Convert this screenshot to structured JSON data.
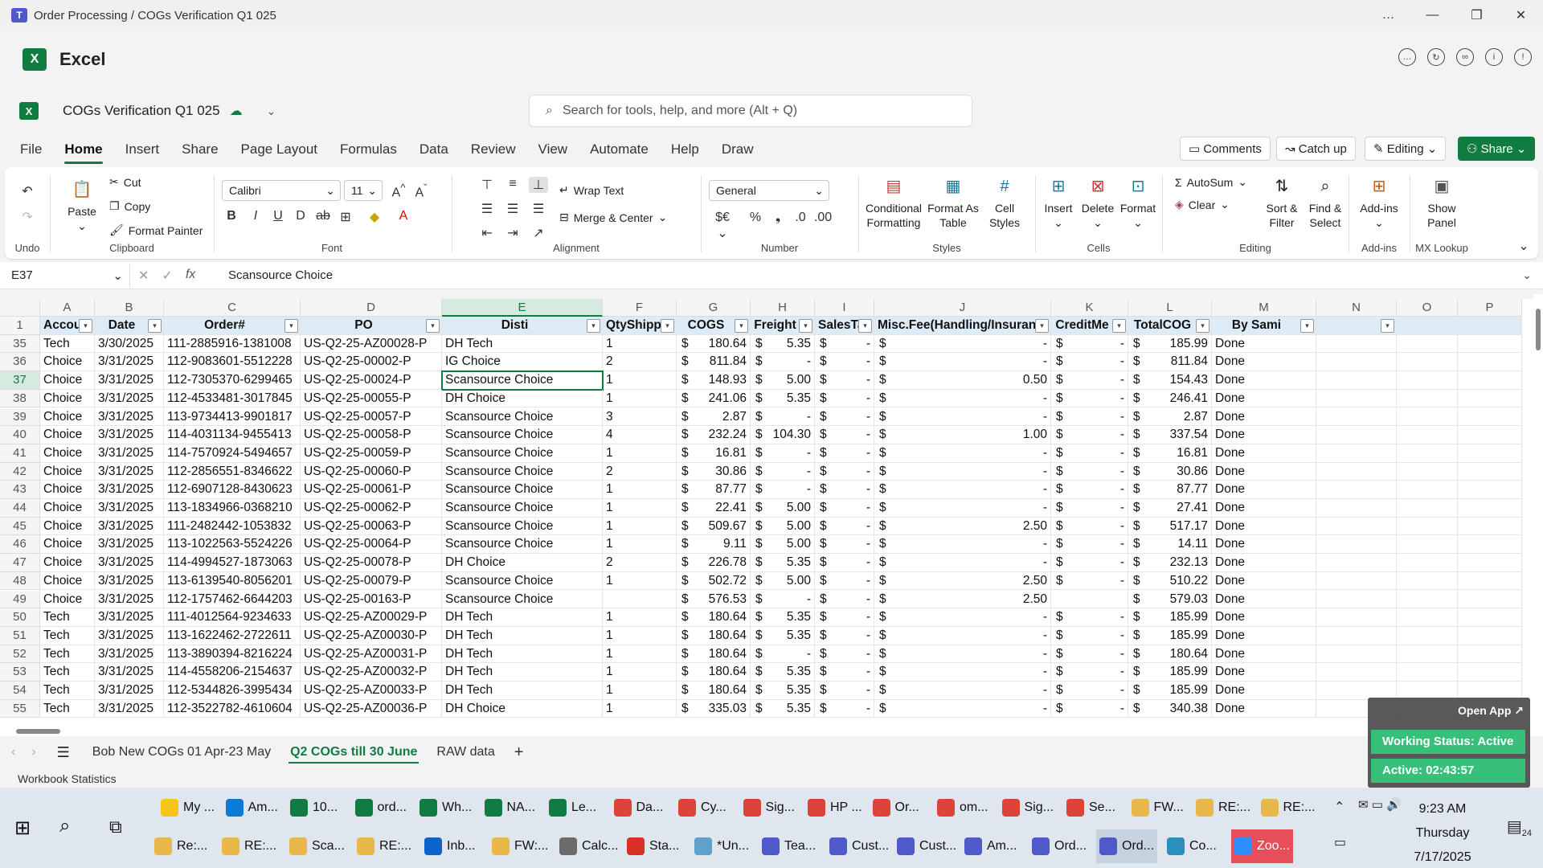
{
  "window": {
    "title": "Order Processing / COGs Verification Q1 025",
    "controls": [
      "…",
      "—",
      "❐",
      "✕"
    ]
  },
  "app": {
    "name": "Excel",
    "logo": "X"
  },
  "file": {
    "name": "COGs Verification Q1 025"
  },
  "search": {
    "placeholder": "Search for tools, help, and more (Alt + Q)"
  },
  "menu": {
    "tabs": [
      "File",
      "Home",
      "Insert",
      "Share",
      "Page Layout",
      "Formulas",
      "Data",
      "Review",
      "View",
      "Automate",
      "Help",
      "Draw"
    ],
    "active": "Home",
    "comments": "Comments",
    "catchup": "Catch up",
    "editing": "Editing",
    "share": "Share"
  },
  "ribbon": {
    "undo_label": "Undo",
    "clipboard": {
      "paste": "Paste",
      "cut": "Cut",
      "copy": "Copy",
      "format_painter": "Format Painter",
      "label": "Clipboard"
    },
    "font": {
      "name": "Calibri",
      "size": "11",
      "label": "Font"
    },
    "alignment": {
      "wrap": "Wrap Text",
      "merge": "Merge & Center",
      "label": "Alignment"
    },
    "number": {
      "format": "General",
      "label": "Number"
    },
    "styles": {
      "conditional": "Conditional Formatting",
      "format_table": "Format As Table",
      "cell_styles": "Cell Styles",
      "label": "Styles"
    },
    "cells": {
      "insert": "Insert",
      "delete": "Delete",
      "format": "Format",
      "label": "Cells"
    },
    "editing": {
      "autosum": "AutoSum",
      "clear": "Clear",
      "sort": "Sort & Filter",
      "find": "Find & Select",
      "label": "Editing"
    },
    "addins": {
      "label_btn": "Add-ins",
      "label": "Add-ins"
    },
    "mxlookup": {
      "btn": "Show Panel",
      "label": "MX Lookup"
    }
  },
  "formula_bar": {
    "cell_ref": "E37",
    "value": "Scansource Choice",
    "fx": "fx"
  },
  "grid": {
    "columns": [
      "A",
      "B",
      "C",
      "D",
      "E",
      "F",
      "G",
      "H",
      "I",
      "J",
      "K",
      "L",
      "M",
      "N",
      "O",
      "P"
    ],
    "selected_column": "E",
    "headers": [
      "Accou",
      "Date",
      "Order#",
      "PO",
      "Disti",
      "QtyShipp",
      "COGS",
      "Freight",
      "SalesTa",
      "Misc.Fee(Handling/Insuranc",
      "CreditMe",
      "TotalCOG",
      "By Sami",
      "",
      "",
      ""
    ],
    "rows": [
      {
        "n": "35",
        "a": "Tech",
        "b": "3/30/2025",
        "c": "111-2885916-1381008",
        "d": "US-Q2-25-AZ00028-P",
        "e": "DH Tech",
        "f": "1",
        "g": "180.64",
        "h": "5.35",
        "i": "-",
        "j": "-",
        "k": "-",
        "l": "185.99",
        "m": "Done"
      },
      {
        "n": "36",
        "a": "Choice",
        "b": "3/31/2025",
        "c": "112-9083601-5512228",
        "d": "US-Q2-25-00002-P",
        "e": "IG Choice",
        "f": "2",
        "g": "811.84",
        "h": "-",
        "i": "-",
        "j": "-",
        "k": "-",
        "l": "811.84",
        "m": "Done"
      },
      {
        "n": "37",
        "a": "Choice",
        "b": "3/31/2025",
        "c": "112-7305370-6299465",
        "d": "US-Q2-25-00024-P",
        "e": "Scansource Choice",
        "f": "1",
        "g": "148.93",
        "h": "5.00",
        "i": "-",
        "j": "0.50",
        "k": "-",
        "l": "154.43",
        "m": "Done"
      },
      {
        "n": "38",
        "a": "Choice",
        "b": "3/31/2025",
        "c": "112-4533481-3017845",
        "d": "US-Q2-25-00055-P",
        "e": "DH Choice",
        "f": "1",
        "g": "241.06",
        "h": "5.35",
        "i": "-",
        "j": "-",
        "k": "-",
        "l": "246.41",
        "m": "Done"
      },
      {
        "n": "39",
        "a": "Choice",
        "b": "3/31/2025",
        "c": "113-9734413-9901817",
        "d": "US-Q2-25-00057-P",
        "e": "Scansource Choice",
        "f": "3",
        "g": "2.87",
        "h": "-",
        "i": "-",
        "j": "-",
        "k": "-",
        "l": "2.87",
        "m": "Done"
      },
      {
        "n": "40",
        "a": "Choice",
        "b": "3/31/2025",
        "c": "114-4031134-9455413",
        "d": "US-Q2-25-00058-P",
        "e": "Scansource Choice",
        "f": "4",
        "g": "232.24",
        "h": "104.30",
        "i": "-",
        "j": "1.00",
        "k": "-",
        "l": "337.54",
        "m": "Done"
      },
      {
        "n": "41",
        "a": "Choice",
        "b": "3/31/2025",
        "c": "114-7570924-5494657",
        "d": "US-Q2-25-00059-P",
        "e": "Scansource Choice",
        "f": "1",
        "g": "16.81",
        "h": "-",
        "i": "-",
        "j": "-",
        "k": "-",
        "l": "16.81",
        "m": "Done"
      },
      {
        "n": "42",
        "a": "Choice",
        "b": "3/31/2025",
        "c": "112-2856551-8346622",
        "d": "US-Q2-25-00060-P",
        "e": "Scansource Choice",
        "f": "2",
        "g": "30.86",
        "h": "-",
        "i": "-",
        "j": "-",
        "k": "-",
        "l": "30.86",
        "m": "Done"
      },
      {
        "n": "43",
        "a": "Choice",
        "b": "3/31/2025",
        "c": "112-6907128-8430623",
        "d": "US-Q2-25-00061-P",
        "e": "Scansource Choice",
        "f": "1",
        "g": "87.77",
        "h": "-",
        "i": "-",
        "j": "-",
        "k": "-",
        "l": "87.77",
        "m": "Done"
      },
      {
        "n": "44",
        "a": "Choice",
        "b": "3/31/2025",
        "c": "113-1834966-0368210",
        "d": "US-Q2-25-00062-P",
        "e": "Scansource Choice",
        "f": "1",
        "g": "22.41",
        "h": "5.00",
        "i": "-",
        "j": "-",
        "k": "-",
        "l": "27.41",
        "m": "Done"
      },
      {
        "n": "45",
        "a": "Choice",
        "b": "3/31/2025",
        "c": "111-2482442-1053832",
        "d": "US-Q2-25-00063-P",
        "e": "Scansource Choice",
        "f": "1",
        "g": "509.67",
        "h": "5.00",
        "i": "-",
        "j": "2.50",
        "k": "-",
        "l": "517.17",
        "m": "Done"
      },
      {
        "n": "46",
        "a": "Choice",
        "b": "3/31/2025",
        "c": "113-1022563-5524226",
        "d": "US-Q2-25-00064-P",
        "e": "Scansource Choice",
        "f": "1",
        "g": "9.11",
        "h": "5.00",
        "i": "-",
        "j": "-",
        "k": "-",
        "l": "14.11",
        "m": "Done"
      },
      {
        "n": "47",
        "a": "Choice",
        "b": "3/31/2025",
        "c": "114-4994527-1873063",
        "d": "US-Q2-25-00078-P",
        "e": "DH Choice",
        "f": "2",
        "g": "226.78",
        "h": "5.35",
        "i": "-",
        "j": "-",
        "k": "-",
        "l": "232.13",
        "m": "Done"
      },
      {
        "n": "48",
        "a": "Choice",
        "b": "3/31/2025",
        "c": "113-6139540-8056201",
        "d": "US-Q2-25-00079-P",
        "e": "Scansource Choice",
        "f": "1",
        "g": "502.72",
        "h": "5.00",
        "i": "-",
        "j": "2.50",
        "k": "-",
        "l": "510.22",
        "m": "Done"
      },
      {
        "n": "49",
        "a": "Choice",
        "b": "3/31/2025",
        "c": "112-1757462-6644203",
        "d": "US-Q2-25-00163-P",
        "e": "Scansource Choice",
        "f": "",
        "g": "576.53",
        "h": "-",
        "i": "-",
        "j": "2.50",
        "k": "",
        "l": "579.03",
        "m": "Done"
      },
      {
        "n": "50",
        "a": "Tech",
        "b": "3/31/2025",
        "c": "111-4012564-9234633",
        "d": "US-Q2-25-AZ00029-P",
        "e": "DH Tech",
        "f": "1",
        "g": "180.64",
        "h": "5.35",
        "i": "-",
        "j": "-",
        "k": "-",
        "l": "185.99",
        "m": "Done"
      },
      {
        "n": "51",
        "a": "Tech",
        "b": "3/31/2025",
        "c": "113-1622462-2722611",
        "d": "US-Q2-25-AZ00030-P",
        "e": "DH Tech",
        "f": "1",
        "g": "180.64",
        "h": "5.35",
        "i": "-",
        "j": "-",
        "k": "-",
        "l": "185.99",
        "m": "Done"
      },
      {
        "n": "52",
        "a": "Tech",
        "b": "3/31/2025",
        "c": "113-3890394-8216224",
        "d": "US-Q2-25-AZ00031-P",
        "e": "DH Tech",
        "f": "1",
        "g": "180.64",
        "h": "-",
        "i": "-",
        "j": "-",
        "k": "-",
        "l": "180.64",
        "m": "Done"
      },
      {
        "n": "53",
        "a": "Tech",
        "b": "3/31/2025",
        "c": "114-4558206-2154637",
        "d": "US-Q2-25-AZ00032-P",
        "e": "DH Tech",
        "f": "1",
        "g": "180.64",
        "h": "5.35",
        "i": "-",
        "j": "-",
        "k": "-",
        "l": "185.99",
        "m": "Done"
      },
      {
        "n": "54",
        "a": "Tech",
        "b": "3/31/2025",
        "c": "112-5344826-3995434",
        "d": "US-Q2-25-AZ00033-P",
        "e": "DH Tech",
        "f": "1",
        "g": "180.64",
        "h": "5.35",
        "i": "-",
        "j": "-",
        "k": "-",
        "l": "185.99",
        "m": "Done"
      },
      {
        "n": "55",
        "a": "Tech",
        "b": "3/31/2025",
        "c": "112-3522782-4610604",
        "d": "US-Q2-25-AZ00036-P",
        "e": "DH Choice",
        "f": "1",
        "g": "335.03",
        "h": "5.35",
        "i": "-",
        "j": "-",
        "k": "-",
        "l": "340.38",
        "m": "Done"
      }
    ],
    "currency_symbol": "$",
    "active_row": "37"
  },
  "sheets": {
    "tabs": [
      "Bob New COGs 01 Apr-23 May",
      "Q2 COGs till 30 June",
      "RAW data"
    ],
    "active": "Q2 COGs till 30 June",
    "add": "+"
  },
  "status": {
    "left": "Workbook Statistics"
  },
  "widget": {
    "open": "Open App ↗",
    "status": "Working Status: Active",
    "active": "Active: 02:43:57"
  },
  "taskbar": {
    "row1": [
      {
        "label": "My ...",
        "color": "#f5c518",
        "icon": "folder-icon"
      },
      {
        "label": "Am...",
        "color": "#0c7bd6",
        "icon": "edge-icon"
      },
      {
        "label": "10...",
        "color": "#107c41",
        "icon": "excel-icon"
      },
      {
        "label": "ord...",
        "color": "#107c41",
        "icon": "excel-icon"
      },
      {
        "label": "Wh...",
        "color": "#107c41",
        "icon": "excel-icon"
      },
      {
        "label": "NA...",
        "color": "#107c41",
        "icon": "excel-icon"
      },
      {
        "label": "Le...",
        "color": "#107c41",
        "icon": "excel-icon"
      },
      {
        "label": "Da...",
        "color": "#db4437",
        "icon": "chrome-icon"
      },
      {
        "label": "Cy...",
        "color": "#db4437",
        "icon": "chrome-icon"
      },
      {
        "label": "Sig...",
        "color": "#db4437",
        "icon": "chrome-icon"
      },
      {
        "label": "HP ...",
        "color": "#db4437",
        "icon": "chrome-icon"
      },
      {
        "label": "Or...",
        "color": "#db4437",
        "icon": "chrome-icon"
      },
      {
        "label": "om...",
        "color": "#db4437",
        "icon": "chrome-icon"
      },
      {
        "label": "Sig...",
        "color": "#db4437",
        "icon": "chrome-icon"
      },
      {
        "label": "Se...",
        "color": "#db4437",
        "icon": "chrome-icon"
      },
      {
        "label": "FW...",
        "color": "#e8b84a",
        "icon": "mail-icon"
      },
      {
        "label": "RE:...",
        "color": "#e8b84a",
        "icon": "mail-icon"
      },
      {
        "label": "RE:...",
        "color": "#e8b84a",
        "icon": "mail-icon"
      }
    ],
    "row2": [
      {
        "label": "Re:...",
        "color": "#e8b84a",
        "icon": "mail-icon"
      },
      {
        "label": "RE:...",
        "color": "#e8b84a",
        "icon": "mail-icon"
      },
      {
        "label": "Sca...",
        "color": "#e8b84a",
        "icon": "mail-icon"
      },
      {
        "label": "RE:...",
        "color": "#e8b84a",
        "icon": "mail-icon"
      },
      {
        "label": "Inb...",
        "color": "#0a64c9",
        "icon": "outlook-icon"
      },
      {
        "label": "FW:...",
        "color": "#e8b84a",
        "icon": "mail-icon"
      },
      {
        "label": "Calc...",
        "color": "#6b6b6b",
        "icon": "calculator-icon"
      },
      {
        "label": "Sta...",
        "color": "#d93025",
        "icon": "pdf-icon"
      },
      {
        "label": "*Un...",
        "color": "#5ea1c9",
        "icon": "notepad-icon"
      },
      {
        "label": "Tea...",
        "color": "#5059c9",
        "icon": "teams-icon"
      },
      {
        "label": "Cust...",
        "color": "#5059c9",
        "icon": "teams-icon"
      },
      {
        "label": "Cust...",
        "color": "#5059c9",
        "icon": "teams-icon"
      },
      {
        "label": "Am...",
        "color": "#5059c9",
        "icon": "teams-icon"
      },
      {
        "label": "Ord...",
        "color": "#5059c9",
        "icon": "teams-icon"
      },
      {
        "label": "Ord...",
        "color": "#5059c9",
        "icon": "teams-icon"
      },
      {
        "label": "Co...",
        "color": "#2a8fbd",
        "icon": "app-icon"
      },
      {
        "label": "Zoo...",
        "color": "#2d8cff",
        "icon": "zoom-icon"
      }
    ],
    "clock_time": "9:23 AM",
    "clock_day": "Thursday",
    "clock_date": "7/17/2025",
    "notif_count": "24"
  }
}
